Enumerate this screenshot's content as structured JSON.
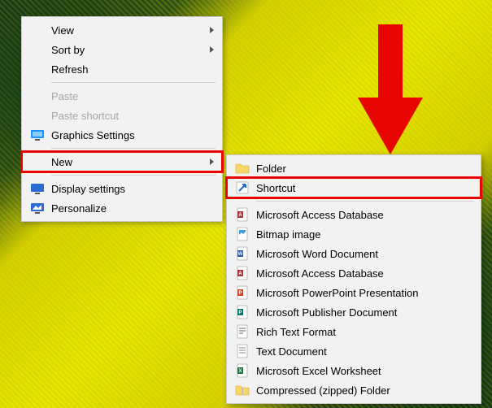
{
  "main_menu": {
    "view": "View",
    "sortby": "Sort by",
    "refresh": "Refresh",
    "paste": "Paste",
    "paste_shortcut": "Paste shortcut",
    "graphics": "Graphics Settings",
    "new": "New",
    "display": "Display settings",
    "personalize": "Personalize"
  },
  "sub_menu": {
    "folder": "Folder",
    "shortcut": "Shortcut",
    "access_db": "Microsoft Access Database",
    "bitmap": "Bitmap image",
    "word_doc": "Microsoft Word Document",
    "access_db2": "Microsoft Access Database",
    "ppt": "Microsoft PowerPoint Presentation",
    "publisher": "Microsoft Publisher Document",
    "rtf": "Rich Text Format",
    "text": "Text Document",
    "excel": "Microsoft Excel Worksheet",
    "zip": "Compressed (zipped) Folder"
  }
}
